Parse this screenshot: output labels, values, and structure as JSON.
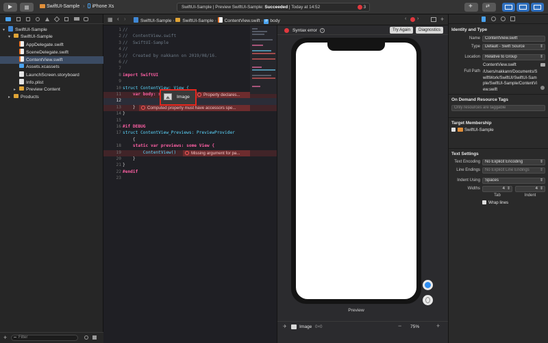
{
  "toolbar": {
    "scheme_target": "SwiftUI-Sample",
    "device": "iPhone Xs",
    "status_project": "SwiftUI-Sample",
    "status_message": "Preview SwiftUI-Sample:",
    "status_result": "Succeeded",
    "status_time": "Today at 14:52",
    "error_count": "3"
  },
  "navigator": {
    "items": [
      {
        "label": "SwiftUI-Sample",
        "icon": "project-icon",
        "level": 0
      },
      {
        "label": "SwiftUI-Sample",
        "icon": "folder-icon",
        "level": 1
      },
      {
        "label": "AppDelegate.swift",
        "icon": "swift-file-icon",
        "level": 2
      },
      {
        "label": "SceneDelegate.swift",
        "icon": "swift-file-icon",
        "level": 2
      },
      {
        "label": "ContentView.swift",
        "icon": "swift-file-icon",
        "level": 2,
        "selected": true
      },
      {
        "label": "Assets.xcassets",
        "icon": "folder-icon",
        "level": 2
      },
      {
        "label": "LaunchScreen.storyboard",
        "icon": "file-icon",
        "level": 2
      },
      {
        "label": "Info.plist",
        "icon": "file-icon",
        "level": 2
      },
      {
        "label": "Preview Content",
        "icon": "folder-icon",
        "level": 2
      },
      {
        "label": "Products",
        "icon": "folder-icon",
        "level": 1
      }
    ],
    "filter_placeholder": "Filter"
  },
  "jumpbar": {
    "crumbs": [
      "SwiftUI-Sample",
      "SwiftUI-Sample",
      "ContentView.swift",
      "body"
    ]
  },
  "editor": {
    "lines": [
      {
        "n": "1",
        "t": "//"
      },
      {
        "n": "2",
        "t": "//  ContentView.swift"
      },
      {
        "n": "3",
        "t": "//  SwiftUI-Sample"
      },
      {
        "n": "4",
        "t": "//"
      },
      {
        "n": "5",
        "t": "//  Created by nakkann on 2019/08/16."
      },
      {
        "n": "6",
        "t": "//"
      },
      {
        "n": "7",
        "t": ""
      },
      {
        "n": "8",
        "t": "import SwiftUI"
      },
      {
        "n": "9",
        "t": ""
      },
      {
        "n": "10",
        "t": "struct ContentView: View {"
      },
      {
        "n": "11",
        "t": "    var body: some View {"
      },
      {
        "n": "12",
        "t": ""
      },
      {
        "n": "13",
        "t": "    }"
      },
      {
        "n": "14",
        "t": "}"
      },
      {
        "n": "15",
        "t": ""
      },
      {
        "n": "16",
        "t": "#if DEBUG"
      },
      {
        "n": "17",
        "t": "struct ContentView_Previews: PreviewProvider"
      },
      {
        "n": "",
        "t": "    {"
      },
      {
        "n": "18",
        "t": "    static var previews: some View {"
      },
      {
        "n": "19",
        "t": "        ContentView()"
      },
      {
        "n": "20",
        "t": "    }"
      },
      {
        "n": "21",
        "t": "}"
      },
      {
        "n": "22",
        "t": "#endif"
      },
      {
        "n": "23",
        "t": ""
      }
    ],
    "errors": {
      "e1": "Property declares...",
      "e2": "Computed property must have accessors spe...",
      "e3": "Missing argument for pa..."
    },
    "popup_label": "Image"
  },
  "canvas": {
    "syntax_error": "Syntax error",
    "try_again": "Try Again",
    "diagnostics": "Diagnostics",
    "preview_label": "Preview",
    "selection_name": "Image",
    "selection_size": "0×0",
    "zoom": "75%"
  },
  "inspector": {
    "identity_title": "Identity and Type",
    "name_label": "Name",
    "name_value": "ContentView.swift",
    "type_label": "Type",
    "type_value": "Default - Swift Source",
    "location_label": "Location",
    "location_value": "Relative to Group",
    "location_file": "ContentView.swift",
    "fullpath_label": "Full Path",
    "fullpath_value": "/Users/nakkann/Documents/SwiftWork/SwiftUI/SwiftUI-Sample/SwiftUI-Sample/ContentView.swift",
    "odr_title": "On Demand Resource Tags",
    "odr_placeholder": "Only resources are taggable",
    "membership_title": "Target Membership",
    "membership_target": "SwiftUI-Sample",
    "text_settings_title": "Text Settings",
    "encoding_label": "Text Encoding",
    "encoding_value": "No Explicit Encoding",
    "line_endings_label": "Line Endings",
    "line_endings_value": "No Explicit Line Endings",
    "indent_label": "Indent Using",
    "indent_value": "Spaces",
    "widths_label": "Widths",
    "tab_value": "4",
    "indent_value_num": "4",
    "tab_label": "Tab",
    "indent_sub_label": "Indent",
    "wrap_label": "Wrap lines"
  }
}
